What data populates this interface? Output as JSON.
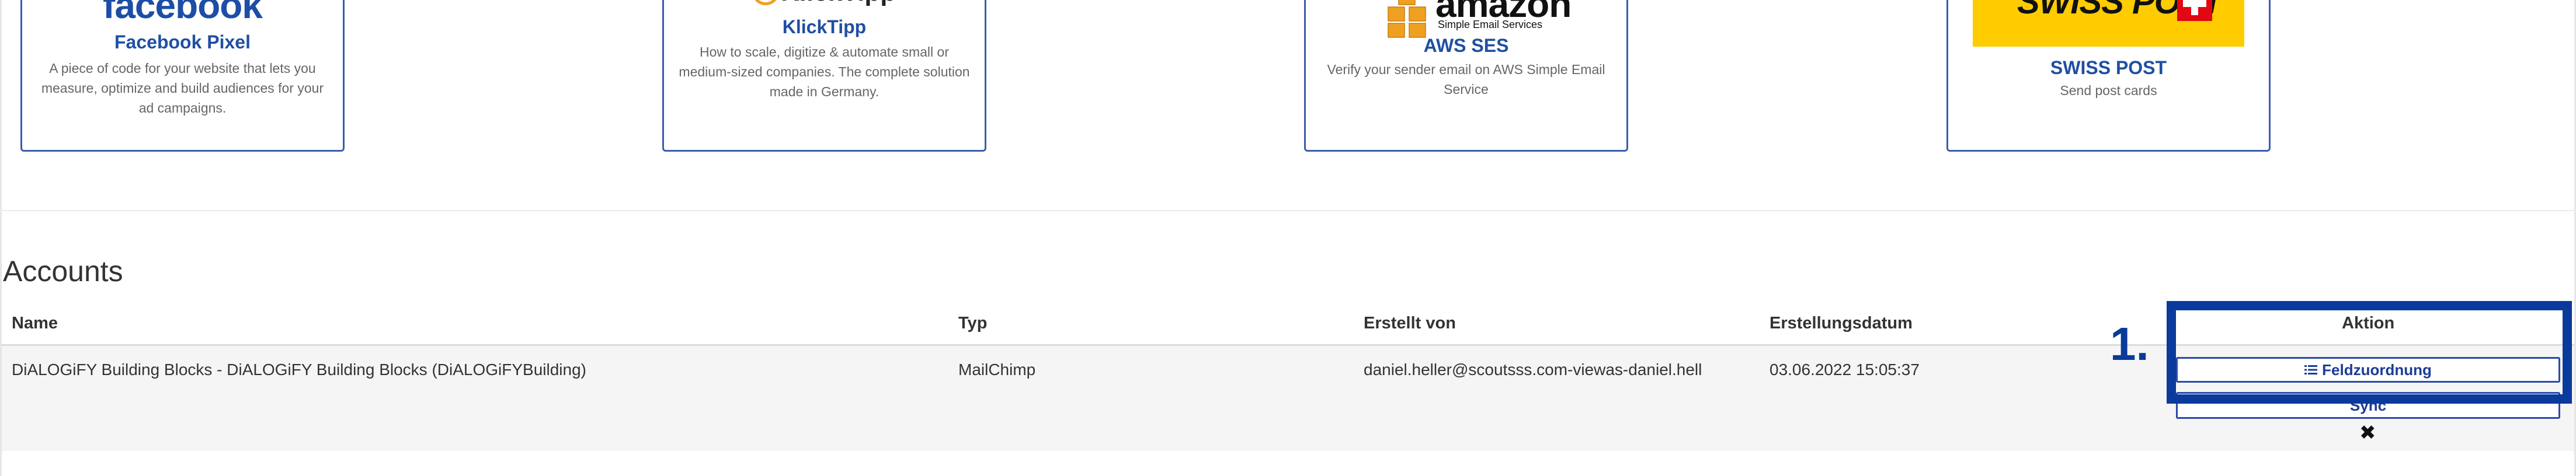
{
  "integrations": [
    {
      "logo_text": "facebook",
      "title": "Facebook Pixel",
      "description": "A piece of code for your website that lets you measure, optimize and build audiences for your ad campaigns."
    },
    {
      "logo_text": "KlickTipp",
      "title": "KlickTipp",
      "description": "How to scale, digitize & automate small or medium-sized companies. The complete solution made in Germany."
    },
    {
      "logo_text": "amazon",
      "logo_subtext": "Simple Email Services",
      "title": "AWS SES",
      "description": "Verify your sender email on AWS Simple Email Service"
    },
    {
      "logo_text": "SWISS POST",
      "title": "SWISS POST",
      "description": "Send post cards"
    }
  ],
  "accounts": {
    "title": "Accounts",
    "columns": {
      "name": "Name",
      "typ": "Typ",
      "erstellt_von": "Erstellt von",
      "erstellungsdatum": "Erstellungsdatum",
      "aktion": "Aktion"
    },
    "rows": [
      {
        "name": "DiALOGiFY Building Blocks - DiALOGiFY Building Blocks (DiALOGiFYBuilding)",
        "typ": "MailChimp",
        "erstellt_von": "daniel.heller@scoutsss.com-viewas-daniel.hell",
        "erstellungsdatum": "03.06.2022 15:05:37",
        "actions": {
          "field_mapping_label": "Feldzuordnung",
          "second_button_label": "Sync",
          "delete_icon": "close-icon"
        }
      }
    ]
  },
  "annotation": {
    "number_label": "1.",
    "color": "#0a3a9c"
  },
  "colors": {
    "accent": "#1f4fa3",
    "card_border": "#3a5dae",
    "swiss_yellow": "#ffcc00",
    "swiss_red": "#e30613",
    "amazon_orange": "#f0a021"
  }
}
